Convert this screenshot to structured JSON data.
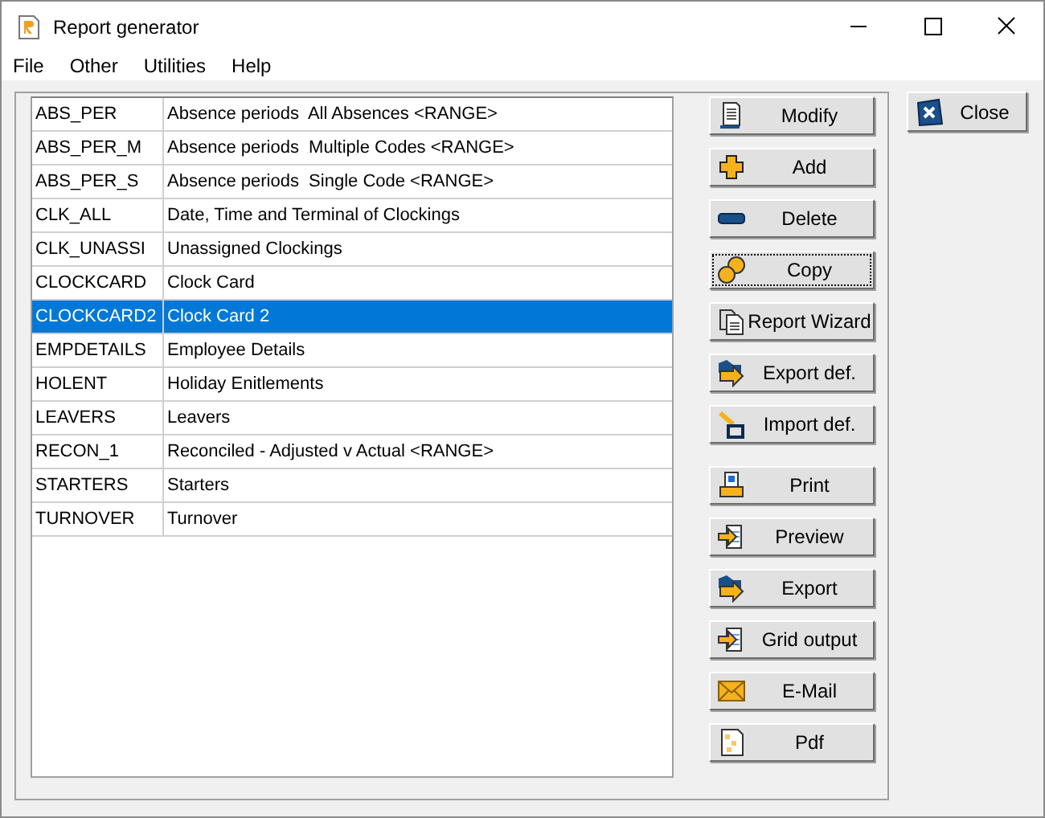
{
  "window": {
    "title": "Report generator"
  },
  "menu": [
    "File",
    "Other",
    "Utilities",
    "Help"
  ],
  "reports": [
    {
      "code": "ABS_PER",
      "description": "Absence periods  All Absences <RANGE>",
      "selected": false
    },
    {
      "code": "ABS_PER_M",
      "description": "Absence periods  Multiple Codes <RANGE>",
      "selected": false
    },
    {
      "code": "ABS_PER_S",
      "description": "Absence periods  Single Code <RANGE>",
      "selected": false
    },
    {
      "code": "CLK_ALL",
      "description": "Date, Time and Terminal of Clockings",
      "selected": false
    },
    {
      "code": "CLK_UNASSI",
      "description": "Unassigned Clockings",
      "selected": false
    },
    {
      "code": "CLOCKCARD",
      "description": "Clock Card",
      "selected": false
    },
    {
      "code": "CLOCKCARD2",
      "description": "Clock Card 2",
      "selected": true
    },
    {
      "code": "EMPDETAILS",
      "description": "Employee Details",
      "selected": false
    },
    {
      "code": "HOLENT",
      "description": "Holiday Enitlements",
      "selected": false
    },
    {
      "code": "LEAVERS",
      "description": "Leavers",
      "selected": false
    },
    {
      "code": "RECON_1",
      "description": "Reconciled - Adjusted v Actual <RANGE>",
      "selected": false
    },
    {
      "code": "STARTERS",
      "description": "Starters",
      "selected": false
    },
    {
      "code": "TURNOVER",
      "description": "Turnover",
      "selected": false
    }
  ],
  "buttons": [
    {
      "label": "Modify",
      "focused": false
    },
    {
      "label": "Add",
      "focused": false
    },
    {
      "label": "Delete",
      "focused": false
    },
    {
      "label": "Copy",
      "focused": true
    },
    {
      "label": "Report Wizard",
      "focused": false
    },
    {
      "label": "Export def.",
      "focused": false
    },
    {
      "label": "Import def.",
      "focused": false
    },
    {
      "label": "Print",
      "focused": false
    },
    {
      "label": "Preview",
      "focused": false
    },
    {
      "label": "Export",
      "focused": false
    },
    {
      "label": "Grid output",
      "focused": false
    },
    {
      "label": "E-Mail",
      "focused": false
    },
    {
      "label": "Pdf",
      "focused": false
    }
  ],
  "close_button": {
    "label": "Close"
  }
}
